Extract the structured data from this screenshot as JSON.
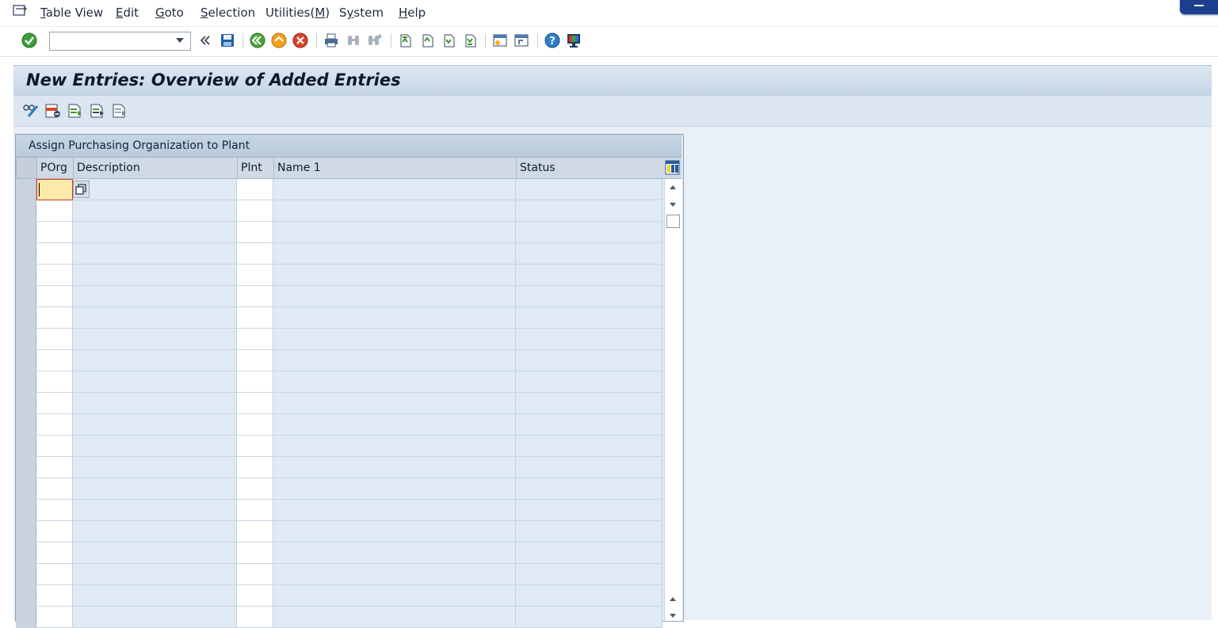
{
  "menubar": {
    "items": [
      {
        "pre": "",
        "key": "T",
        "post": "able View"
      },
      {
        "pre": "",
        "key": "E",
        "post": "dit"
      },
      {
        "pre": "",
        "key": "G",
        "post": "oto"
      },
      {
        "pre": "",
        "key": "S",
        "post": "election"
      },
      {
        "pre": "Utilities(",
        "key": "M",
        "post": ")"
      },
      {
        "pre": "S",
        "key": "y",
        "post": "stem"
      },
      {
        "pre": "",
        "key": "H",
        "post": "elp"
      }
    ]
  },
  "toolbar": {
    "command_field_value": "",
    "icons": [
      "enter-checkmark-icon",
      "command-dropdown-icon",
      "collapse-icon",
      "save-icon",
      "back-icon",
      "exit-icon",
      "cancel-icon",
      "print-icon",
      "find-icon",
      "find-next-icon",
      "first-page-icon",
      "previous-page-icon",
      "next-page-icon",
      "last-page-icon",
      "create-session-icon",
      "create-shortcut-icon",
      "help-icon",
      "customize-layout-icon"
    ]
  },
  "page": {
    "title": "New Entries: Overview of Added Entries"
  },
  "app_toolbar": {
    "icons": [
      "change-display-icon",
      "delete-row-icon",
      "select-all-icon",
      "select-block-icon",
      "deselect-all-icon"
    ]
  },
  "table": {
    "title": "Assign Purchasing Organization to Plant",
    "columns": [
      "POrg",
      "Description",
      "Plnt",
      "Name 1",
      "Status"
    ],
    "rows": [
      [
        "",
        "",
        "",
        "",
        ""
      ],
      [
        "",
        "",
        "",
        "",
        ""
      ],
      [
        "",
        "",
        "",
        "",
        ""
      ],
      [
        "",
        "",
        "",
        "",
        ""
      ],
      [
        "",
        "",
        "",
        "",
        ""
      ],
      [
        "",
        "",
        "",
        "",
        ""
      ],
      [
        "",
        "",
        "",
        "",
        ""
      ],
      [
        "",
        "",
        "",
        "",
        ""
      ],
      [
        "",
        "",
        "",
        "",
        ""
      ],
      [
        "",
        "",
        "",
        "",
        ""
      ],
      [
        "",
        "",
        "",
        "",
        ""
      ],
      [
        "",
        "",
        "",
        "",
        ""
      ],
      [
        "",
        "",
        "",
        "",
        ""
      ],
      [
        "",
        "",
        "",
        "",
        ""
      ],
      [
        "",
        "",
        "",
        "",
        ""
      ],
      [
        "",
        "",
        "",
        "",
        ""
      ],
      [
        "",
        "",
        "",
        "",
        ""
      ],
      [
        "",
        "",
        "",
        "",
        ""
      ],
      [
        "",
        "",
        "",
        "",
        ""
      ],
      [
        "",
        "",
        "",
        "",
        ""
      ],
      [
        "",
        "",
        "",
        "",
        ""
      ]
    ]
  },
  "colors": {
    "title_bar": "#c4d4e4",
    "background": "#eaf0f7",
    "focused_cell": "#fde9a9",
    "focus_border": "#d23a2a"
  }
}
